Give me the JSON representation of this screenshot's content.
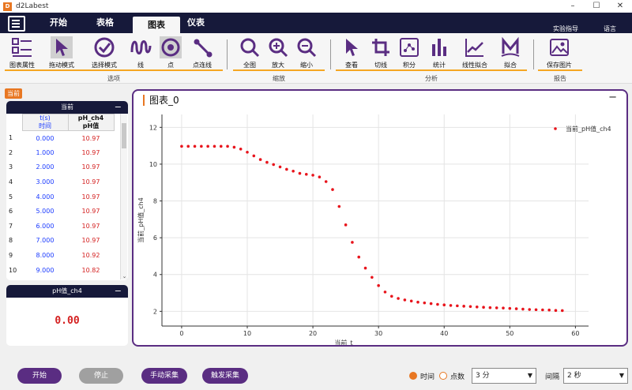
{
  "window": {
    "title": "d2Labest",
    "icon": "app-icon",
    "controls": [
      "–",
      "☐",
      "✕"
    ]
  },
  "menu": {
    "tabs": [
      {
        "label": "开始"
      },
      {
        "label": "表格"
      },
      {
        "label": "图表",
        "active": true
      },
      {
        "label": "仪表"
      }
    ],
    "right_links": [
      "实验指导",
      "语言"
    ]
  },
  "ribbon": {
    "buttons": [
      {
        "label": "图表属性",
        "icon": "chart-properties-icon"
      },
      {
        "label": "拖动模式",
        "icon": "cursor-drag-icon",
        "selected": true
      },
      {
        "label": "选择模式",
        "icon": "check-circle-icon"
      },
      {
        "label": "线",
        "icon": "line-wave-icon"
      },
      {
        "label": "点",
        "icon": "point-icon",
        "selected": true
      },
      {
        "label": "点连线",
        "icon": "point-line-icon"
      },
      {
        "label": "全图",
        "icon": "zoom-fit-icon"
      },
      {
        "label": "放大",
        "icon": "zoom-in-icon"
      },
      {
        "label": "缩小",
        "icon": "zoom-out-icon"
      },
      {
        "label": "查看",
        "icon": "cursor-view-icon"
      },
      {
        "label": "切线",
        "icon": "tangent-icon"
      },
      {
        "label": "积分",
        "icon": "integral-icon"
      },
      {
        "label": "统计",
        "icon": "statistics-icon"
      },
      {
        "label": "线性拟合",
        "icon": "linear-fit-icon"
      },
      {
        "label": "拟合",
        "icon": "fit-icon"
      },
      {
        "label": "保存图片",
        "icon": "save-image-icon"
      }
    ],
    "groups": [
      "选项",
      "缩放",
      "分析",
      "报告"
    ]
  },
  "current_badge": "当前",
  "data_panel": {
    "title": "当前",
    "col1_header": [
      "t(s)",
      "时间"
    ],
    "col2_header": [
      "pH_ch4",
      "pH值"
    ],
    "rows": [
      {
        "n": "1",
        "t": "0.000",
        "ph": "10.97"
      },
      {
        "n": "2",
        "t": "1.000",
        "ph": "10.97"
      },
      {
        "n": "3",
        "t": "2.000",
        "ph": "10.97"
      },
      {
        "n": "4",
        "t": "3.000",
        "ph": "10.97"
      },
      {
        "n": "5",
        "t": "4.000",
        "ph": "10.97"
      },
      {
        "n": "6",
        "t": "5.000",
        "ph": "10.97"
      },
      {
        "n": "7",
        "t": "6.000",
        "ph": "10.97"
      },
      {
        "n": "8",
        "t": "7.000",
        "ph": "10.97"
      },
      {
        "n": "9",
        "t": "8.000",
        "ph": "10.92"
      },
      {
        "n": "10",
        "t": "9.000",
        "ph": "10.82"
      }
    ]
  },
  "meter_panel": {
    "title": "pH值_ch4",
    "value": "0.00"
  },
  "chart_panel": {
    "title": "图表_0"
  },
  "chart_data": {
    "type": "scatter",
    "xlabel": "当前_t",
    "ylabel": "当前_pH值_ch4",
    "xlim": [
      -3,
      62
    ],
    "ylim": [
      1.2,
      12.7
    ],
    "xticks": [
      0,
      10,
      20,
      30,
      40,
      50,
      60
    ],
    "yticks": [
      2,
      4,
      6,
      8,
      10,
      12
    ],
    "grid": true,
    "legend": "top-right",
    "series": [
      {
        "name": "当前_pH值_ch4",
        "color": "#e8141c",
        "x": [
          0,
          1,
          2,
          3,
          4,
          5,
          6,
          7,
          8,
          9,
          10,
          11,
          12,
          13,
          14,
          15,
          16,
          17,
          18,
          19,
          20,
          21,
          22,
          23,
          24,
          25,
          26,
          27,
          28,
          29,
          30,
          31,
          32,
          33,
          34,
          35,
          36,
          37,
          38,
          39,
          40,
          41,
          42,
          43,
          44,
          45,
          46,
          47,
          48,
          49,
          50,
          51,
          52,
          53,
          54,
          55,
          56,
          57,
          58
        ],
        "y": [
          10.97,
          10.97,
          10.97,
          10.97,
          10.97,
          10.97,
          10.97,
          10.97,
          10.92,
          10.82,
          10.65,
          10.45,
          10.25,
          10.1,
          9.98,
          9.85,
          9.72,
          9.62,
          9.5,
          9.45,
          9.4,
          9.3,
          9.05,
          8.62,
          7.7,
          6.7,
          5.75,
          4.95,
          4.35,
          3.85,
          3.4,
          3.05,
          2.82,
          2.7,
          2.62,
          2.56,
          2.5,
          2.46,
          2.42,
          2.38,
          2.35,
          2.32,
          2.3,
          2.28,
          2.26,
          2.24,
          2.22,
          2.2,
          2.19,
          2.18,
          2.16,
          2.14,
          2.12,
          2.1,
          2.09,
          2.08,
          2.07,
          2.05,
          2.04
        ]
      }
    ]
  },
  "bottom": {
    "start": "开始",
    "stop": "停止",
    "manual": "手动采集",
    "trigger": "触发采集",
    "radio_time": "时间",
    "radio_points": "点数",
    "duration": "3 分",
    "interval_label": "间隔",
    "interval": "2 秒",
    "colors": {
      "primary": "#5a2d82",
      "disabled": "#a0a0a0",
      "accent": "#e87722"
    }
  }
}
